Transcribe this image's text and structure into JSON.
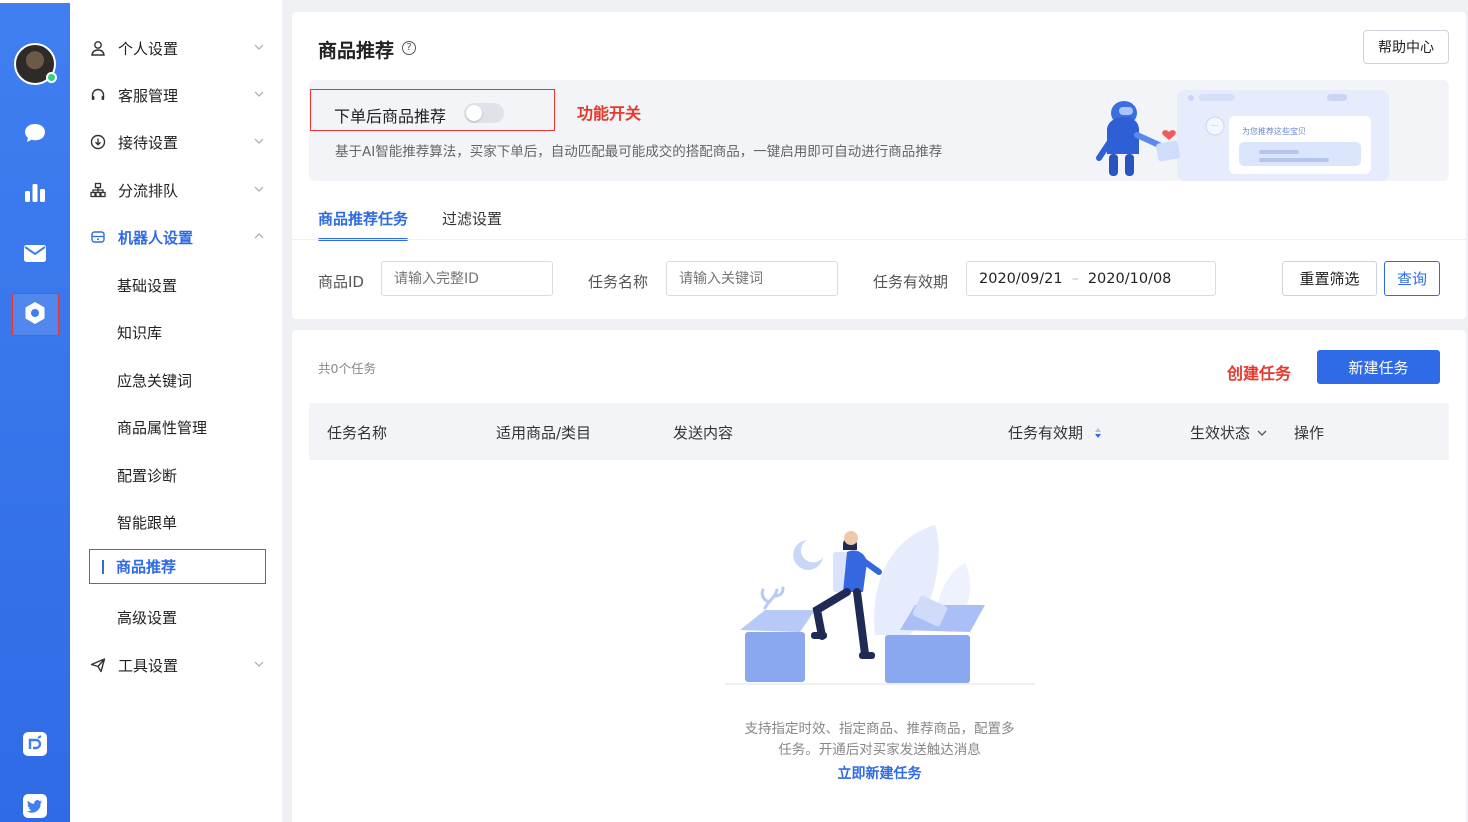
{
  "rail": {
    "icons": [
      "chat-bubble-icon",
      "bar-chart-icon",
      "mail-icon",
      "settings-gear-icon",
      "app-logo-icon",
      "twitter-bird-icon"
    ]
  },
  "sidebar": {
    "items": [
      {
        "label": "个人设置",
        "icon": "user-icon"
      },
      {
        "label": "客服管理",
        "icon": "headset-icon"
      },
      {
        "label": "接待设置",
        "icon": "download-circle-icon"
      },
      {
        "label": "分流排队",
        "icon": "org-tree-icon"
      },
      {
        "label": "机器人设置",
        "icon": "robot-icon"
      },
      {
        "label": "工具设置",
        "icon": "paper-plane-icon"
      }
    ],
    "sub_items": [
      "基础设置",
      "知识库",
      "应急关键词",
      "商品属性管理",
      "配置诊断",
      "智能跟单",
      "商品推荐",
      "高级设置"
    ]
  },
  "header": {
    "title": "商品推荐",
    "help_glyph": "?",
    "help_button": "帮助中心"
  },
  "banner": {
    "toggle_label": "下单后商品推荐",
    "annotation": "功能开关",
    "description": "基于AI智能推荐算法，买家下单后，自动匹配最可能成交的搭配商品，一键启用即可自动进行商品推荐",
    "art_card_text": "为您推荐这些宝贝",
    "art_bubble_text": "···"
  },
  "tabs": [
    "商品推荐任务",
    "过滤设置"
  ],
  "filters": {
    "product_id_label": "商品ID",
    "product_id_placeholder": "请输入完整ID",
    "task_name_label": "任务名称",
    "task_name_placeholder": "请输入关键词",
    "validity_label": "任务有效期",
    "date_start": "2020/09/21",
    "date_sep": "–",
    "date_end": "2020/10/08",
    "reset_button": "重置筛选",
    "query_button": "查询"
  },
  "tasks": {
    "count_text": "共0个任务",
    "annotation": "创建任务",
    "new_button": "新建任务",
    "columns": [
      "任务名称",
      "适用商品/类目",
      "发送内容",
      "任务有效期",
      "生效状态",
      "操作"
    ],
    "empty_line1": "支持指定时效、指定商品、推荐商品，配置多",
    "empty_line2": "任务。开通后对买家发送触达消息",
    "empty_link": "立即新建任务"
  },
  "colors": {
    "primary": "#2f6be6",
    "annotation_red": "#e8382b"
  }
}
